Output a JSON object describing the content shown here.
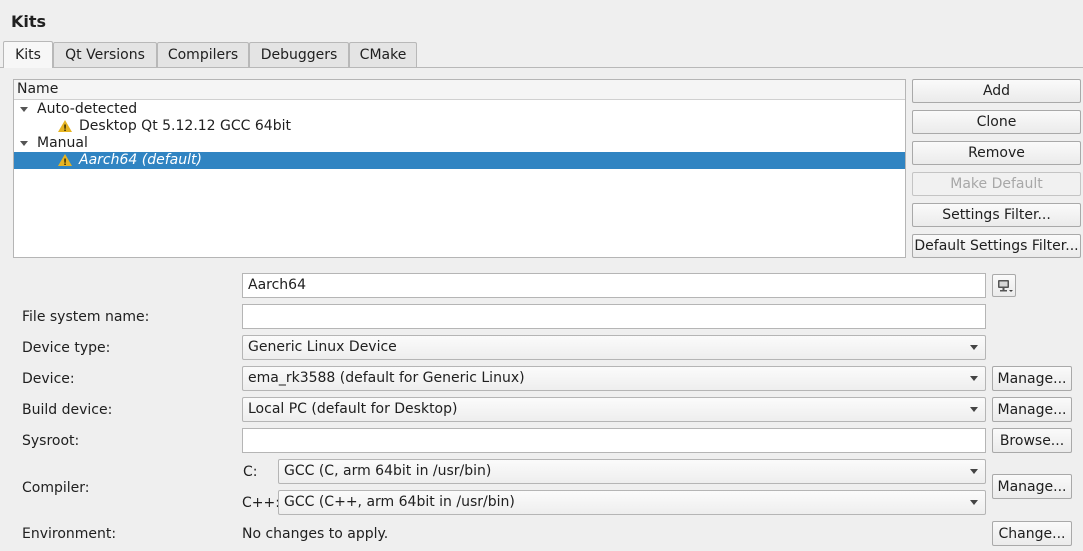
{
  "page": {
    "heading": "Kits"
  },
  "tabs": [
    {
      "label": "Kits",
      "active": true
    },
    {
      "label": "Qt Versions",
      "active": false
    },
    {
      "label": "Compilers",
      "active": false
    },
    {
      "label": "Debuggers",
      "active": false
    },
    {
      "label": "CMake",
      "active": false
    }
  ],
  "tree": {
    "column_header": "Name",
    "groups": [
      {
        "label": "Auto-detected",
        "items": [
          {
            "label": "Desktop Qt 5.12.12 GCC 64bit",
            "icon": "warning-icon",
            "selected": false
          }
        ]
      },
      {
        "label": "Manual",
        "items": [
          {
            "label": "Aarch64 (default)",
            "icon": "warning-icon",
            "selected": true
          }
        ]
      }
    ]
  },
  "actions": {
    "add": "Add",
    "clone": "Clone",
    "remove": "Remove",
    "make_default": "Make Default",
    "settings_filter": "Settings Filter...",
    "default_settings_filter": "Default Settings Filter..."
  },
  "form": {
    "kit_name": "Aarch64",
    "file_system_name": {
      "label": "File system name:",
      "value": ""
    },
    "device_type": {
      "label": "Device type:",
      "value": "Generic Linux Device"
    },
    "device": {
      "label": "Device:",
      "value": "ema_rk3588 (default for Generic Linux)",
      "button": "Manage..."
    },
    "build_device": {
      "label": "Build device:",
      "value": "Local PC (default for Desktop)",
      "button": "Manage..."
    },
    "sysroot": {
      "label": "Sysroot:",
      "value": "",
      "button": "Browse..."
    },
    "compiler": {
      "label": "Compiler:",
      "c_label": "C:",
      "c_value": "GCC (C, arm 64bit in /usr/bin)",
      "cpp_label": "C++:",
      "cpp_value": "GCC (C++, arm 64bit in /usr/bin)",
      "button": "Manage..."
    },
    "environment": {
      "label": "Environment:",
      "value": "No changes to apply.",
      "button": "Change..."
    }
  },
  "colors": {
    "selection": "#3084c2",
    "warning": "#e6b422"
  }
}
